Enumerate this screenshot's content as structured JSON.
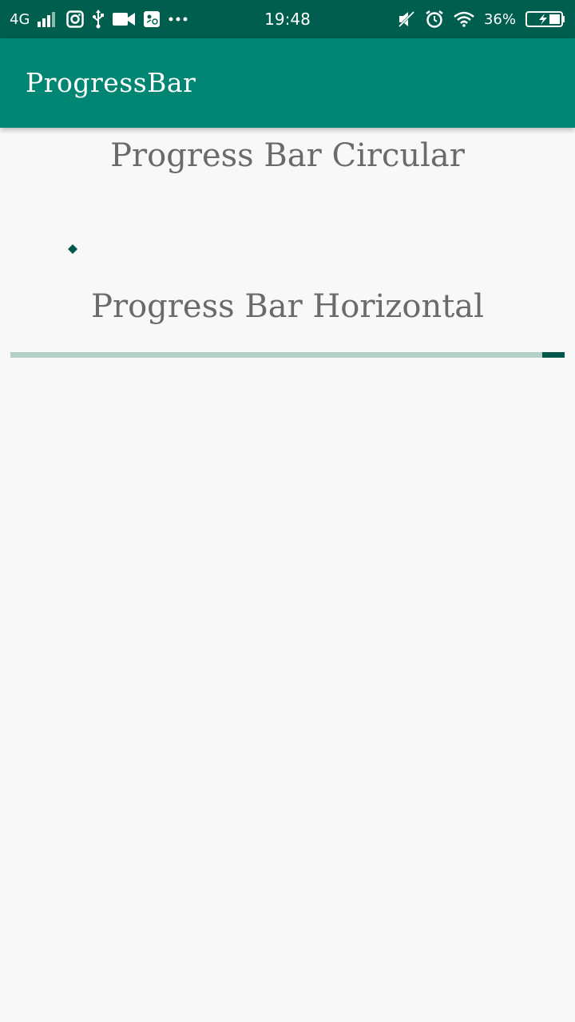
{
  "status_bar": {
    "network": "4G",
    "time": "19:48",
    "battery_percent": "36%",
    "icons": [
      "signal-icon",
      "instagram-icon",
      "usb-icon",
      "video-camera-icon",
      "image-icon",
      "more-dots-icon",
      "mute-icon",
      "alarm-icon",
      "wifi-icon",
      "battery-charging-icon"
    ]
  },
  "app_bar": {
    "title": "ProgressBar"
  },
  "main": {
    "circular_heading": "Progress Bar Circular",
    "horizontal_heading": "Progress Bar Horizontal",
    "horizontal_progress": {
      "mode": "indeterminate",
      "indicator_start": 0.96,
      "indicator_end": 1.0
    }
  },
  "colors": {
    "status_bar": "#005e4e",
    "app_bar": "#008672",
    "accent": "#00574b",
    "track": "#b2cfc8",
    "heading_text": "#6a6a6a",
    "background": "#f8f8f8"
  }
}
